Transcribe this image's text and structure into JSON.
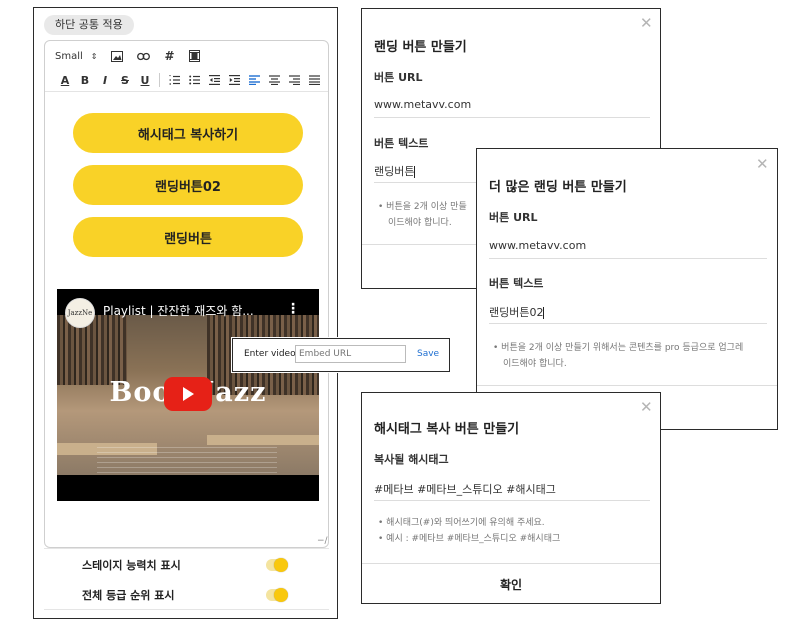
{
  "left_panel": {
    "tag": "하단 공통 적용",
    "toolbar": {
      "font_size": "Small",
      "row1_icons": [
        "image-icon",
        "link-icon",
        "hashtag-icon",
        "video-icon"
      ],
      "hashtag_glyph": "#",
      "format_letters": {
        "text_color": "A",
        "bold": "B",
        "italic": "I",
        "strike": "S",
        "underline": "U"
      }
    },
    "buttons": [
      "해시태그 복사하기",
      "랜딩버튼02",
      "랜딩버튼"
    ],
    "video": {
      "channel": "JazzNe",
      "title": "Playlist | 잔잔한 재즈와 함...",
      "overlay": "Book  Jazz"
    },
    "settings": [
      {
        "label": "스테이지 능력치 표시",
        "on": true
      },
      {
        "label": "전체 등급 순위 표시",
        "on": true
      }
    ]
  },
  "embed_popup": {
    "label": "Enter video:",
    "placeholder": "Embed URL",
    "save_label": "Save"
  },
  "dialog_landing": {
    "title": "랜딩 버튼 만들기",
    "url_label": "버튼 URL",
    "url_value": "www.metavv.com",
    "text_label": "버튼 텍스트",
    "text_value": "랜딩버튼",
    "note_line1": "버튼을 2개 이상 만들",
    "note_line2": "이드해야 합니다."
  },
  "dialog_more": {
    "title": "더 많은 랜딩 버튼 만들기",
    "url_label": "버튼 URL",
    "url_value": "www.metavv.com",
    "text_label": "버튼 텍스트",
    "text_value": "랜딩버튼02",
    "note_line1": "버튼을 2개 이상 만들기 위해서는 콘텐츠를 pro 등급으로 업그레",
    "note_line2": "이드해야 합니다."
  },
  "dialog_hashtag": {
    "title": "해시태그 복사 버튼 만들기",
    "label": "복사될 해시태그",
    "value": "#메타브 #메타브_스튜디오 #해시태그",
    "note_line1": "해시태그(#)와 띄어쓰기에 유의해 주세요.",
    "note_line2": "예시 : #메타브 #메타브_스튜디오 #해시태그",
    "confirm_label": "확인"
  },
  "colors": {
    "accent_yellow": "#f9d227",
    "link_blue": "#1f6fd1",
    "video_red": "#e62117"
  }
}
